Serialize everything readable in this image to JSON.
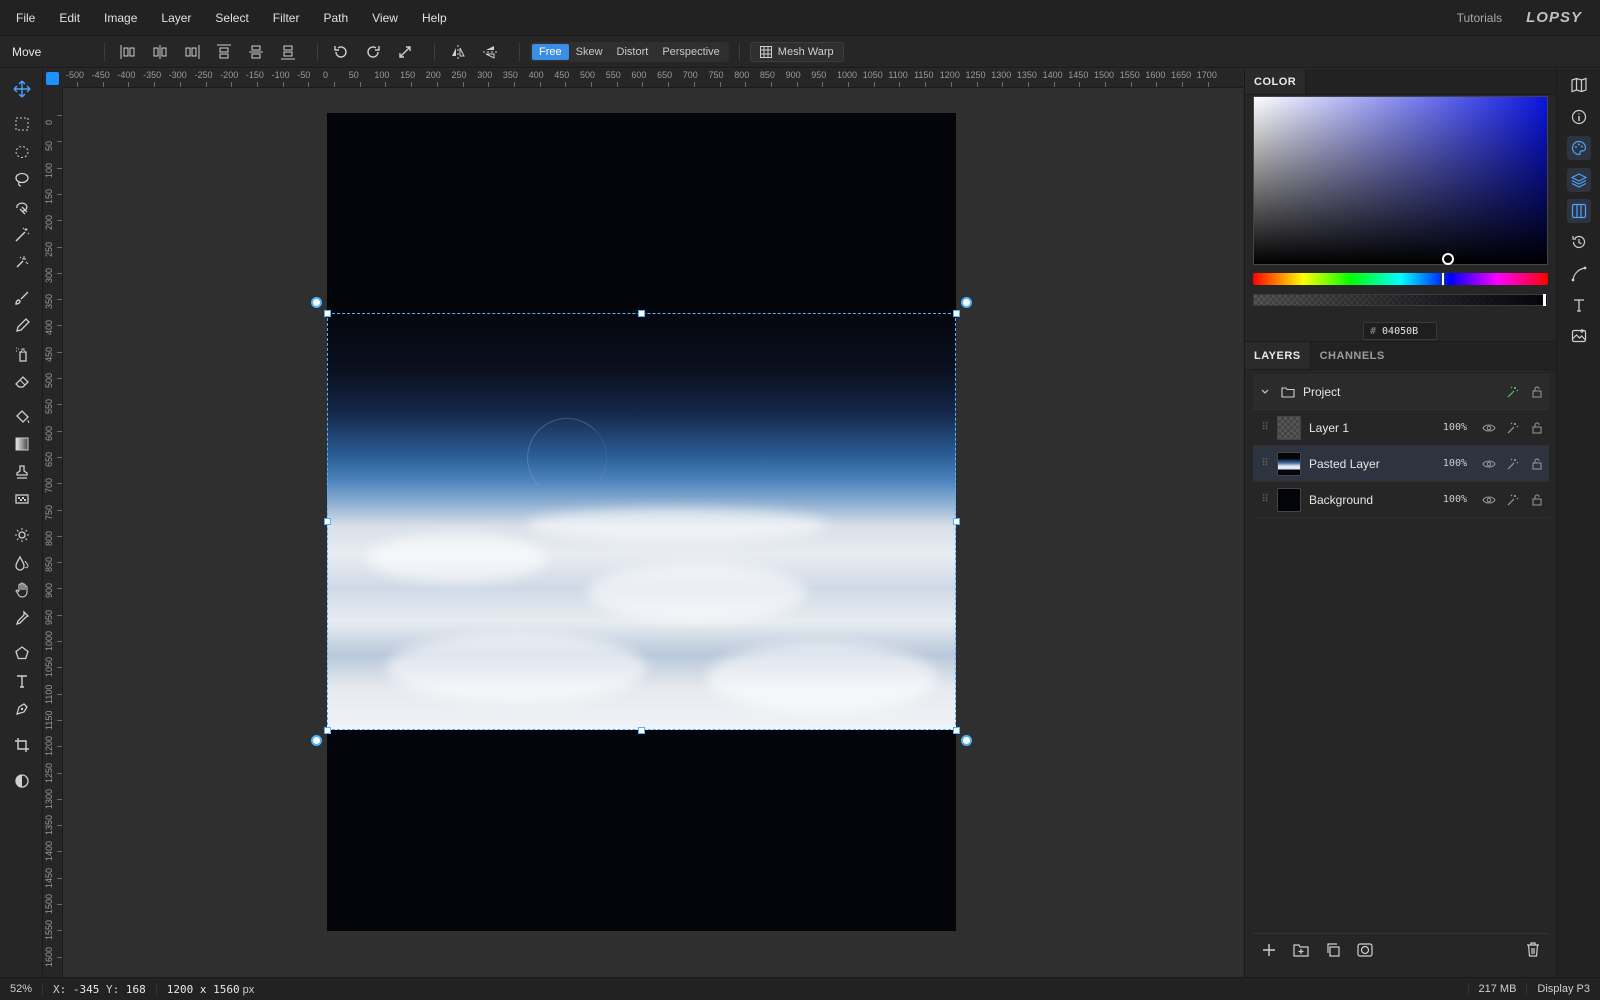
{
  "menu": [
    "File",
    "Edit",
    "Image",
    "Layer",
    "Select",
    "Filter",
    "Path",
    "View",
    "Help"
  ],
  "header": {
    "tutorials": "Tutorials",
    "logo": "LOPSY"
  },
  "options": {
    "tool_name": "Move",
    "modes": [
      "Free",
      "Skew",
      "Distort",
      "Perspective"
    ],
    "active_mode": "Free",
    "mesh_warp": "Mesh Warp"
  },
  "ruler": {
    "top": [
      "-500",
      "-450",
      "-400",
      "-350",
      "-300",
      "-250",
      "-200",
      "-150",
      "-100",
      "-50",
      "0",
      "50",
      "100",
      "150",
      "200",
      "250",
      "300",
      "350",
      "400",
      "450",
      "500",
      "550",
      "600",
      "650",
      "700",
      "750",
      "800",
      "850",
      "900",
      "950",
      "1000",
      "1050",
      "1100",
      "1150",
      "1200",
      "1250",
      "1300",
      "1350",
      "1400",
      "1450",
      "1500",
      "1550",
      "1600",
      "1650",
      "1700"
    ],
    "left": [
      "0",
      "50",
      "100",
      "150",
      "200",
      "250",
      "300",
      "350",
      "400",
      "450",
      "500",
      "550",
      "600",
      "650",
      "700",
      "750",
      "800",
      "850",
      "900",
      "950",
      "1000",
      "1050",
      "1100",
      "1150",
      "1200",
      "1250",
      "1300",
      "1350",
      "1400",
      "1450",
      "1500",
      "1550",
      "1600"
    ]
  },
  "color_panel": {
    "title": "COLOR",
    "hex_prefix": "#",
    "hex": "04050B"
  },
  "layers_panel": {
    "tabs": [
      "LAYERS",
      "CHANNELS"
    ],
    "group": "Project",
    "layers": [
      {
        "name": "Layer 1",
        "opacity": "100%"
      },
      {
        "name": "Pasted Layer",
        "opacity": "100%"
      },
      {
        "name": "Background",
        "opacity": "100%"
      }
    ]
  },
  "status": {
    "zoom": "52%",
    "coords_x_label": "X:",
    "coords_x": "-345",
    "coords_y_label": "Y:",
    "coords_y": "168",
    "doc_size": "1200 x 1560",
    "unit": "px",
    "memory": "217 MB",
    "profile": "Display P3"
  },
  "colors": {
    "accent": "#3a8ee6",
    "selection": "#4db3ff",
    "fill": "#04050b"
  }
}
